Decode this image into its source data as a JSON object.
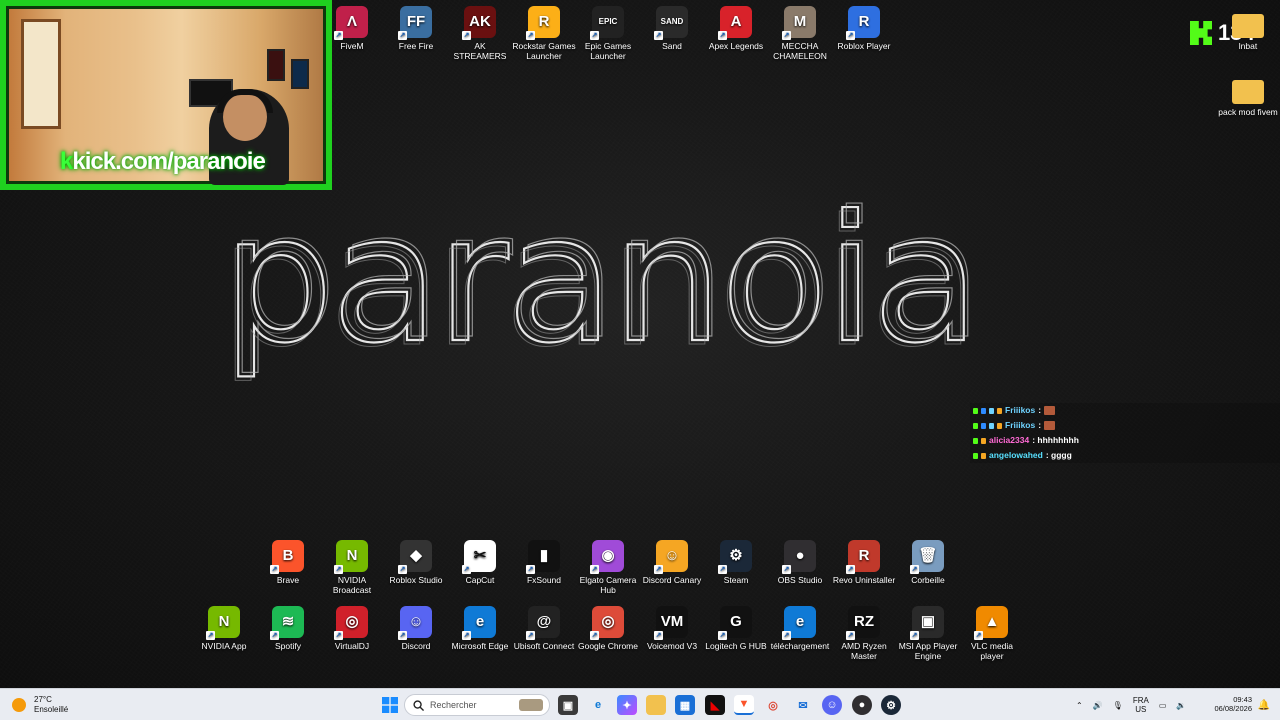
{
  "webcam": {
    "overlay_prefix": "k",
    "overlay_text": "kick.com/paranoie"
  },
  "wallpaper": {
    "word": "paranoia"
  },
  "kick_badge": {
    "viewers": "134"
  },
  "top_icons": [
    {
      "label": "FiveM",
      "color": "#c0204a",
      "glyph": "Λ"
    },
    {
      "label": "Free Fire",
      "color": "#3a6ea0",
      "glyph": "FF"
    },
    {
      "label": "AK STREAMERS",
      "color": "#6a1010",
      "glyph": "AK"
    },
    {
      "label": "Rockstar Games Launcher",
      "color": "#fcaf17",
      "glyph": "R"
    },
    {
      "label": "Epic Games Launcher",
      "color": "#222222",
      "glyph": "EPIC"
    },
    {
      "label": "Sand",
      "color": "#2a2a2a",
      "glyph": "SAND"
    },
    {
      "label": "Apex Legends",
      "color": "#d8222a",
      "glyph": "A"
    },
    {
      "label": "MECCHA CHAMELEON",
      "color": "#8a7a6a",
      "glyph": "M"
    },
    {
      "label": "Roblox Player",
      "color": "#2e6fe0",
      "glyph": "R"
    }
  ],
  "right_icons": [
    {
      "label": "lnbat",
      "color": "#f2c14e",
      "glyph": ""
    },
    {
      "label": "pack mod fivem",
      "color": "#f2c14e",
      "glyph": ""
    }
  ],
  "row1_icons": [
    {
      "label": "Brave",
      "color": "#fb542b",
      "glyph": "B"
    },
    {
      "label": "NVIDIA Broadcast",
      "color": "#76b900",
      "glyph": "N"
    },
    {
      "label": "Roblox Studio",
      "color": "#333333",
      "glyph": "◆"
    },
    {
      "label": "CapCut",
      "color": "#ffffff",
      "glyph": "✂"
    },
    {
      "label": "FxSound",
      "color": "#111111",
      "glyph": "▮"
    },
    {
      "label": "Elgato Camera Hub",
      "color": "#a04bd8",
      "glyph": "◉"
    },
    {
      "label": "Discord Canary",
      "color": "#f5a623",
      "glyph": "☺"
    },
    {
      "label": "Steam",
      "color": "#1b2838",
      "glyph": "⚙"
    },
    {
      "label": "OBS Studio",
      "color": "#302e31",
      "glyph": "●"
    },
    {
      "label": "Revo Uninstaller",
      "color": "#c0392b",
      "glyph": "R"
    },
    {
      "label": "Corbeille",
      "color": "#7a9cbf",
      "glyph": "🗑"
    }
  ],
  "row2_icons": [
    {
      "label": "NVIDIA App",
      "color": "#76b900",
      "glyph": "N"
    },
    {
      "label": "Spotify",
      "color": "#1db954",
      "glyph": "≋"
    },
    {
      "label": "VirtualDJ",
      "color": "#d0202a",
      "glyph": "◎"
    },
    {
      "label": "Discord",
      "color": "#5865f2",
      "glyph": "☺"
    },
    {
      "label": "Microsoft Edge",
      "color": "#0f7ad6",
      "glyph": "e"
    },
    {
      "label": "Ubisoft Connect",
      "color": "#222222",
      "glyph": "@"
    },
    {
      "label": "Google Chrome",
      "color": "#dd4b39",
      "glyph": "◎"
    },
    {
      "label": "Voicemod V3",
      "color": "#111111",
      "glyph": "VM"
    },
    {
      "label": "Logitech G HUB",
      "color": "#111111",
      "glyph": "G"
    },
    {
      "label": "téléchargement",
      "color": "#0f7ad6",
      "glyph": "e"
    },
    {
      "label": "AMD Ryzen Master",
      "color": "#111111",
      "glyph": "RZ"
    },
    {
      "label": "MSI App Player Engine",
      "color": "#2a2a2a",
      "glyph": "▣"
    },
    {
      "label": "VLC media player",
      "color": "#f08a00",
      "glyph": "▲"
    }
  ],
  "chat": [
    {
      "user": "Friiikos",
      "user_color": "#6fd3ff",
      "text": ":",
      "emote": true
    },
    {
      "user": "Friiikos",
      "user_color": "#6fd3ff",
      "text": ":",
      "emote": true
    },
    {
      "user": "alicia2334",
      "user_color": "#ff6ad5",
      "text": ": hhhhhhhh",
      "emote": false
    },
    {
      "user": "angelowahed",
      "user_color": "#58e0ff",
      "text": ": gggg",
      "emote": false
    }
  ],
  "taskbar": {
    "temp": "27°C",
    "weather": "Ensoleillé",
    "search_placeholder": "Rechercher",
    "lang_top": "FRA",
    "lang_bottom": "US",
    "time": "09:43",
    "date": "06/08/2026"
  }
}
